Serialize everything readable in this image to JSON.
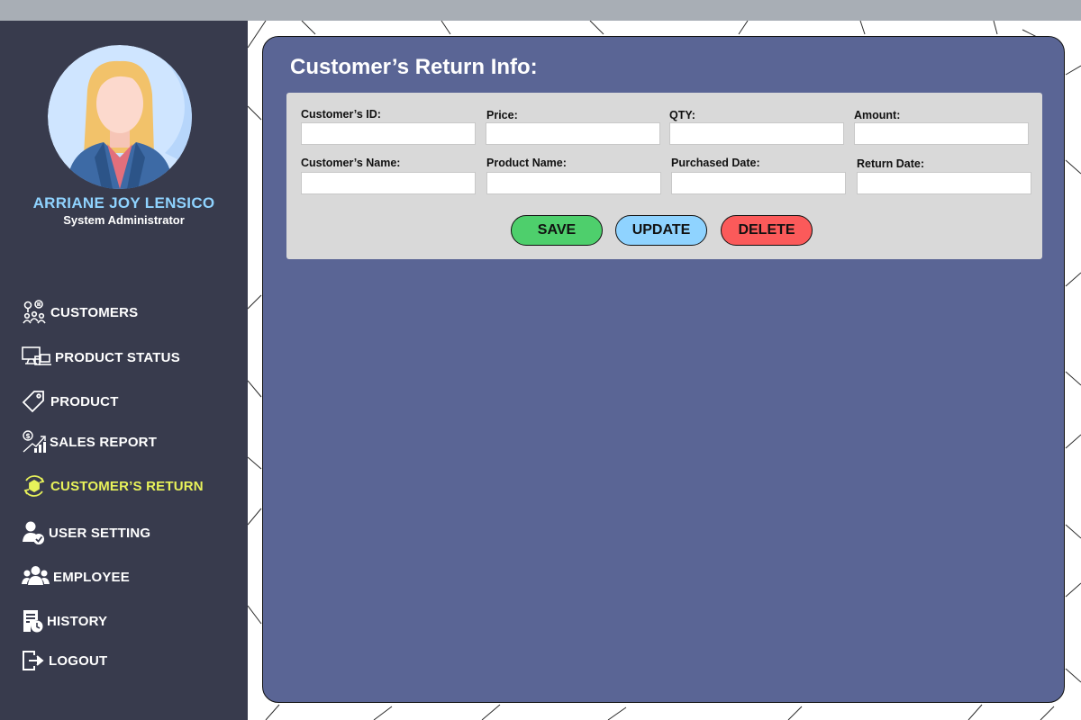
{
  "user": {
    "name": "ARRIANE JOY LENSICO",
    "role": "System Administrator"
  },
  "nav": {
    "items": [
      {
        "label": "CUSTOMERS",
        "icon": "customers-icon"
      },
      {
        "label": "PRODUCT STATUS",
        "icon": "monitor-devices-icon"
      },
      {
        "label": "PRODUCT",
        "icon": "tag-icon"
      },
      {
        "label": "SALES REPORT",
        "icon": "sales-chart-icon"
      },
      {
        "label": "CUSTOMER’S RETURN",
        "icon": "return-box-icon",
        "active": true
      },
      {
        "label": "USER SETTING",
        "icon": "user-check-icon"
      },
      {
        "label": "EMPLOYEE",
        "icon": "group-icon"
      },
      {
        "label": "HISTORY",
        "icon": "history-icon"
      },
      {
        "label": "LOGOUT",
        "icon": "logout-icon"
      }
    ]
  },
  "panel": {
    "title": "Customer’s Return Info:"
  },
  "form": {
    "fields": {
      "customer_id": {
        "label": "Customer’s ID:",
        "value": ""
      },
      "price": {
        "label": "Price:",
        "value": ""
      },
      "qty": {
        "label": "QTY:",
        "value": ""
      },
      "amount": {
        "label": "Amount:",
        "value": ""
      },
      "customer_name": {
        "label": "Customer’s Name:",
        "value": ""
      },
      "product_name": {
        "label": "Product Name:",
        "value": ""
      },
      "purchased_date": {
        "label": "Purchased Date:",
        "value": ""
      },
      "return_date": {
        "label": "Return Date:",
        "value": ""
      }
    },
    "buttons": {
      "save": "SAVE",
      "update": "UPDATE",
      "delete": "DELETE"
    }
  },
  "colors": {
    "sidebar": "#383b4d",
    "panel": "#5a6595",
    "active_nav": "#e8f25a",
    "user_name": "#8fd3ff",
    "save": "#4ecf6c",
    "update": "#8fd3ff",
    "delete": "#fb5a5a"
  }
}
